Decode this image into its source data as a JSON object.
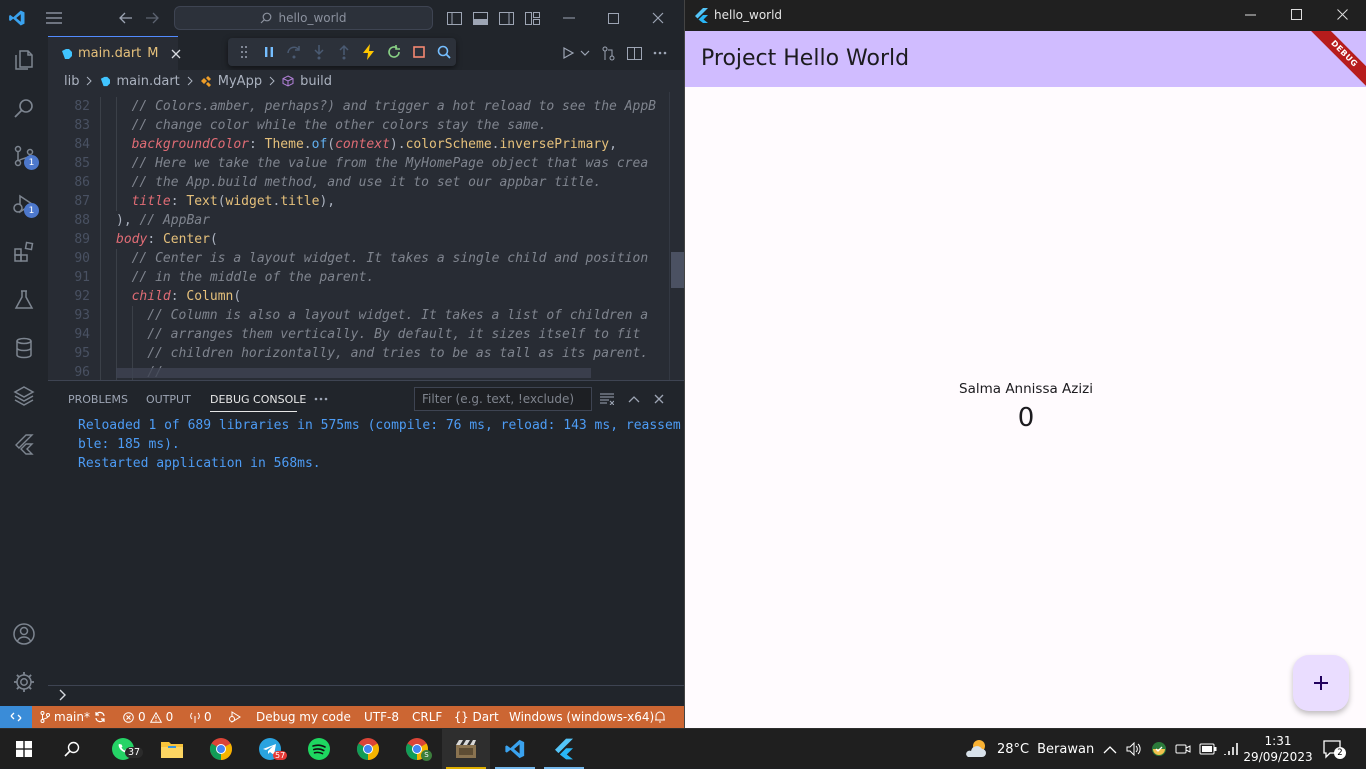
{
  "vscode": {
    "title_search": "hello_world",
    "tab": {
      "filename": "main.dart",
      "status": "M"
    },
    "breadcrumb": [
      "lib",
      "main.dart",
      "MyApp",
      "build"
    ],
    "activity_badges": {
      "source_control": "1",
      "run_debug": "1"
    },
    "code_lines": [
      {
        "n": "82",
        "indent": 4,
        "parts": [
          {
            "t": "// Colors.amber, perhaps?) and trigger a hot reload to see the AppB",
            "c": "cm"
          }
        ]
      },
      {
        "n": "83",
        "indent": 4,
        "parts": [
          {
            "t": "// change color while the other colors stay the same.",
            "c": "cm"
          }
        ]
      },
      {
        "n": "84",
        "indent": 4,
        "parts": [
          {
            "t": "backgroundColor",
            "c": "pr"
          },
          {
            "t": ": ",
            "c": "pl"
          },
          {
            "t": "Theme",
            "c": "cls"
          },
          {
            "t": ".",
            "c": "pl"
          },
          {
            "t": "of",
            "c": "fn"
          },
          {
            "t": "(",
            "c": "pl"
          },
          {
            "t": "context",
            "c": "vr"
          },
          {
            "t": ").",
            "c": "pl"
          },
          {
            "t": "colorScheme",
            "c": "cls"
          },
          {
            "t": ".",
            "c": "pl"
          },
          {
            "t": "inversePrimary",
            "c": "cls"
          },
          {
            "t": ",",
            "c": "pl"
          }
        ]
      },
      {
        "n": "85",
        "indent": 4,
        "parts": [
          {
            "t": "// Here we take the value from the MyHomePage object that was crea",
            "c": "cm"
          }
        ]
      },
      {
        "n": "86",
        "indent": 4,
        "parts": [
          {
            "t": "// the App.build method, and use it to set our appbar title.",
            "c": "cm"
          }
        ]
      },
      {
        "n": "87",
        "indent": 4,
        "parts": [
          {
            "t": "title",
            "c": "pr"
          },
          {
            "t": ": ",
            "c": "pl"
          },
          {
            "t": "Text",
            "c": "cls"
          },
          {
            "t": "(",
            "c": "pl"
          },
          {
            "t": "widget",
            "c": "cls"
          },
          {
            "t": ".",
            "c": "pl"
          },
          {
            "t": "title",
            "c": "cls"
          },
          {
            "t": "),",
            "c": "pl"
          }
        ]
      },
      {
        "n": "88",
        "indent": 3,
        "parts": [
          {
            "t": "), ",
            "c": "pl"
          },
          {
            "t": "// AppBar",
            "c": "cm"
          }
        ]
      },
      {
        "n": "89",
        "indent": 3,
        "parts": [
          {
            "t": "body",
            "c": "pr"
          },
          {
            "t": ": ",
            "c": "pl"
          },
          {
            "t": "Center",
            "c": "cls"
          },
          {
            "t": "(",
            "c": "pl"
          }
        ]
      },
      {
        "n": "90",
        "indent": 4,
        "parts": [
          {
            "t": "// Center is a layout widget. It takes a single child and position",
            "c": "cm"
          }
        ]
      },
      {
        "n": "91",
        "indent": 4,
        "parts": [
          {
            "t": "// in the middle of the parent.",
            "c": "cm"
          }
        ]
      },
      {
        "n": "92",
        "indent": 4,
        "parts": [
          {
            "t": "child",
            "c": "pr"
          },
          {
            "t": ": ",
            "c": "pl"
          },
          {
            "t": "Column",
            "c": "cls"
          },
          {
            "t": "(",
            "c": "pl"
          }
        ]
      },
      {
        "n": "93",
        "indent": 5,
        "parts": [
          {
            "t": "// Column is also a layout widget. It takes a list of children a",
            "c": "cm"
          }
        ]
      },
      {
        "n": "94",
        "indent": 5,
        "parts": [
          {
            "t": "// arranges them vertically. By default, it sizes itself to fit",
            "c": "cm"
          }
        ]
      },
      {
        "n": "95",
        "indent": 5,
        "parts": [
          {
            "t": "// children horizontally, and tries to be as tall as its parent.",
            "c": "cm"
          }
        ]
      },
      {
        "n": "96",
        "indent": 5,
        "parts": [
          {
            "t": "//",
            "c": "cm"
          }
        ]
      }
    ],
    "panel": {
      "tabs": [
        "PROBLEMS",
        "OUTPUT",
        "DEBUG CONSOLE"
      ],
      "active_tab": "DEBUG CONSOLE",
      "filter_placeholder": "Filter (e.g. text, !exclude)",
      "console_lines": [
        "Reloaded 1 of 689 libraries in 575ms (compile: 76 ms, reload: 143 ms, reassem",
        "ble: 185 ms).",
        "Restarted application in 568ms."
      ]
    },
    "status": {
      "branch": "main*",
      "errors": "0",
      "warnings": "0",
      "ports": "0",
      "debug": "Debug my code",
      "encoding": "UTF-8",
      "eol": "CRLF",
      "language": "Dart",
      "platform": "Windows (windows-x64)"
    },
    "colors": {
      "status_bar": "#cc6633",
      "accent": "#528bff"
    }
  },
  "flutter": {
    "window_title": "hello_world",
    "appbar_title": "Project Hello World",
    "ribbon": "DEBUG",
    "name_text": "Salma Annissa Azizi",
    "counter": "0",
    "fab_icon": "plus-icon",
    "colors": {
      "appbar": "#d0bcff",
      "fab": "#eaddff",
      "background": "#fffbfe"
    }
  },
  "taskbar": {
    "whatsapp_badge": "37",
    "telegram_badge": "57",
    "chrome_profile": "S",
    "weather_temp": "28°C",
    "weather_desc": "Berawan",
    "time": "1:31",
    "date": "29/09/2023",
    "notifications": "2"
  }
}
